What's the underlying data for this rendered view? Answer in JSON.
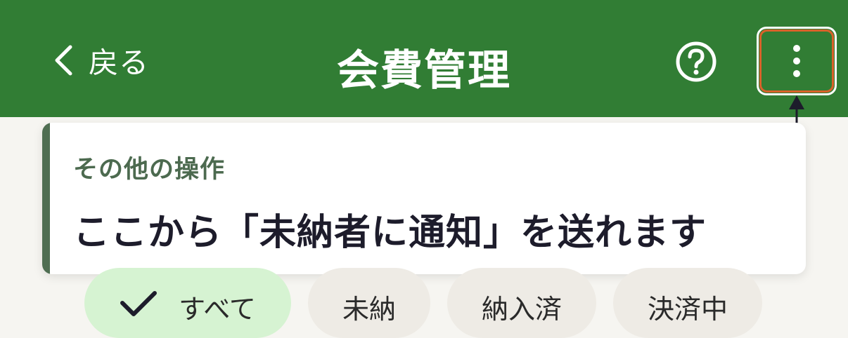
{
  "header": {
    "back_label": "戻る",
    "title": "会費管理",
    "help_icon": "help-circle-icon",
    "more_icon": "more-vertical-icon"
  },
  "tooltip": {
    "heading": "その他の操作",
    "message": "ここから「未納者に通知」を送れます"
  },
  "filters": [
    {
      "label": "すべて",
      "selected": true
    },
    {
      "label": "未納",
      "selected": false
    },
    {
      "label": "納入済",
      "selected": false
    },
    {
      "label": "決済中",
      "selected": false
    }
  ],
  "colors": {
    "appbar": "#317d34",
    "highlight": "#d9622a",
    "tooltip_accent": "#4f6e52",
    "chip_selected": "#d6f3d2"
  }
}
